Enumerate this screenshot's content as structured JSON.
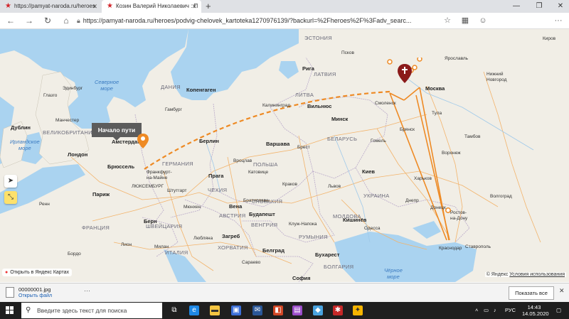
{
  "browser": {
    "tabs": [
      {
        "label": "https://pamyat-naroda.ru/heroes",
        "active": false
      },
      {
        "label": "Козин Валерий Николаевич : П",
        "active": true
      }
    ],
    "new_tab": "+",
    "url": "https://pamyat-naroda.ru/heroes/podvig-chelovek_kartoteka1270976139/?backurl=%2Fheroes%2F%3Fadv_searc..."
  },
  "map": {
    "start_label": "Начало пути",
    "open_yandex": "Открыть в Яндекс Картах",
    "copyright": "© Яндекс",
    "terms": "Условия использования",
    "countries": [
      {
        "id": "estonia",
        "text": "ЭСТОНИЯ"
      },
      {
        "id": "latvia",
        "text": "ЛАТВИЯ"
      },
      {
        "id": "lithuania",
        "text": "ЛИТВА"
      },
      {
        "id": "belarus",
        "text": "БЕЛАРУСЬ"
      },
      {
        "id": "ukraine",
        "text": "УКРАИНА"
      },
      {
        "id": "germany",
        "text": "ГЕРМАНИЯ"
      },
      {
        "id": "poland",
        "text": "ПОЛЬША"
      },
      {
        "id": "france",
        "text": "ФРАНЦИЯ"
      },
      {
        "id": "italy",
        "text": "ИТАЛИЯ"
      },
      {
        "id": "uk",
        "text": "ВЕЛИКОБРИТАНИЯ"
      },
      {
        "id": "denmark",
        "text": "ДАНИЯ"
      },
      {
        "id": "czechia",
        "text": "ЧЕХИЯ"
      },
      {
        "id": "austria",
        "text": "АВСТРИЯ"
      },
      {
        "id": "slovakia",
        "text": "СЛОВАКИЯ"
      },
      {
        "id": "hungary",
        "text": "ВЕНГРИЯ"
      },
      {
        "id": "romania",
        "text": "РУМЫНИЯ"
      },
      {
        "id": "croatia",
        "text": "ХОРВАТИЯ"
      },
      {
        "id": "switzerland",
        "text": "ШВЕЙЦАРИЯ"
      },
      {
        "id": "moldova",
        "text": "МОЛДОВА"
      },
      {
        "id": "bulgaria",
        "text": "БОЛГАРИЯ"
      }
    ],
    "seas": [
      {
        "id": "north-sea",
        "text": "Северное\nморе"
      },
      {
        "id": "irish-sea",
        "text": "Ирландское\nморе"
      },
      {
        "id": "black-sea",
        "text": "Чёрное\nморе"
      }
    ],
    "cities": [
      {
        "id": "moscow",
        "text": "Москва",
        "bold": true
      },
      {
        "id": "riga",
        "text": "Рига",
        "bold": true
      },
      {
        "id": "vilnius",
        "text": "Вильнюс",
        "bold": true
      },
      {
        "id": "minsk",
        "text": "Минск",
        "bold": true
      },
      {
        "id": "kyiv",
        "text": "Киев",
        "bold": true
      },
      {
        "id": "warsaw",
        "text": "Варшава",
        "bold": true
      },
      {
        "id": "berlin",
        "text": "Берлин",
        "bold": true
      },
      {
        "id": "prague",
        "text": "Прага",
        "bold": true
      },
      {
        "id": "vienna",
        "text": "Вена",
        "bold": true
      },
      {
        "id": "budapest",
        "text": "Будапешт",
        "bold": true
      },
      {
        "id": "bratislava",
        "text": "Братислава",
        "bold": false
      },
      {
        "id": "belgrade",
        "text": "Белград",
        "bold": true
      },
      {
        "id": "bucharest",
        "text": "Бухарест",
        "bold": true
      },
      {
        "id": "chisinau",
        "text": "Кишинёв",
        "bold": true
      },
      {
        "id": "sofia",
        "text": "София",
        "bold": true
      },
      {
        "id": "sarajevo",
        "text": "Сарaево",
        "bold": false
      },
      {
        "id": "zagreb",
        "text": "Загреб",
        "bold": true
      },
      {
        "id": "ljubljana",
        "text": "Любляна",
        "bold": false
      },
      {
        "id": "bern",
        "text": "Берн",
        "bold": true
      },
      {
        "id": "paris",
        "text": "Париж",
        "bold": true
      },
      {
        "id": "brussels",
        "text": "Брюссель",
        "bold": true
      },
      {
        "id": "amsterdam",
        "text": "Амстердам",
        "bold": true
      },
      {
        "id": "london",
        "text": "Лондон",
        "bold": true
      },
      {
        "id": "dublin",
        "text": "Дублин",
        "bold": true
      },
      {
        "id": "copenhagen",
        "text": "Копенгаген",
        "bold": true
      },
      {
        "id": "kaliningrad",
        "text": "Калининград",
        "bold": false
      },
      {
        "id": "kharkiv",
        "text": "Харьков",
        "bold": false
      },
      {
        "id": "voronezh",
        "text": "Воронеж",
        "bold": false
      },
      {
        "id": "rostov",
        "text": "Ростов-\nна-Дону",
        "bold": false
      },
      {
        "id": "volgograd",
        "text": "Волгоград",
        "bold": false
      },
      {
        "id": "donetsk",
        "text": "Донецк",
        "bold": false
      },
      {
        "id": "odesa",
        "text": "Одесса",
        "bold": false
      },
      {
        "id": "krasnodar",
        "text": "Краснодар",
        "bold": false
      },
      {
        "id": "stavropol",
        "text": "Ставрополь",
        "bold": false
      },
      {
        "id": "tambov",
        "text": "Тамбов",
        "bold": false
      },
      {
        "id": "bryansk",
        "text": "Брянск",
        "bold": false
      },
      {
        "id": "tula",
        "text": "Тула",
        "bold": false
      },
      {
        "id": "yaroslavl",
        "text": "Ярославль",
        "bold": false
      },
      {
        "id": "nizhny",
        "text": "Нижний\nНовгород",
        "bold": false
      },
      {
        "id": "kirov",
        "text": "Киров",
        "bold": false
      },
      {
        "id": "pskov",
        "text": "Псков",
        "bold": false
      },
      {
        "id": "brest",
        "text": "Брест",
        "bold": false
      },
      {
        "id": "gomel",
        "text": "Гомель",
        "bold": false
      },
      {
        "id": "smolensk",
        "text": "Смоленск",
        "bold": false
      },
      {
        "id": "hamburg",
        "text": "Гамбург",
        "bold": false
      },
      {
        "id": "munich",
        "text": "Мюнхен",
        "bold": false
      },
      {
        "id": "frankfurt",
        "text": "Франкфурт-\nна-Майне",
        "bold": false
      },
      {
        "id": "stuttgart",
        "text": "Штутгарт",
        "bold": false
      },
      {
        "id": "luxembourg",
        "text": "ЛЮКСЕМБУРГ",
        "bold": false
      },
      {
        "id": "lviv",
        "text": "Львов",
        "bold": false
      },
      {
        "id": "krakow",
        "text": "Краков",
        "bold": false
      },
      {
        "id": "katowice",
        "text": "Катовице",
        "bold": false
      },
      {
        "id": "wroclaw",
        "text": "Вроцлав",
        "bold": false
      },
      {
        "id": "dnipro",
        "text": "Днепр",
        "bold": false
      },
      {
        "id": "napoca",
        "text": "Клуж-Напока",
        "bold": false
      },
      {
        "id": "lyon",
        "text": "Лион",
        "bold": false
      },
      {
        "id": "bordeaux",
        "text": "Бордо",
        "bold": false
      },
      {
        "id": "milan",
        "text": "Милан",
        "bold": false
      },
      {
        "id": "rennes",
        "text": "Ренн",
        "bold": false
      },
      {
        "id": "glasgow",
        "text": "Глазго",
        "bold": false
      },
      {
        "id": "manchester",
        "text": "Манчестер",
        "bold": false
      },
      {
        "id": "edinburgh",
        "text": "Эдинбург",
        "bold": false
      }
    ]
  },
  "download": {
    "filename": "00000001.jpg",
    "open": "Открыть файл",
    "more": "···",
    "show_all": "Показать все",
    "close": "✕"
  },
  "taskbar": {
    "search_placeholder": "Введите здесь текст для поиска",
    "lang": "РУС",
    "time": "14:43",
    "date": "14.05.2020"
  }
}
